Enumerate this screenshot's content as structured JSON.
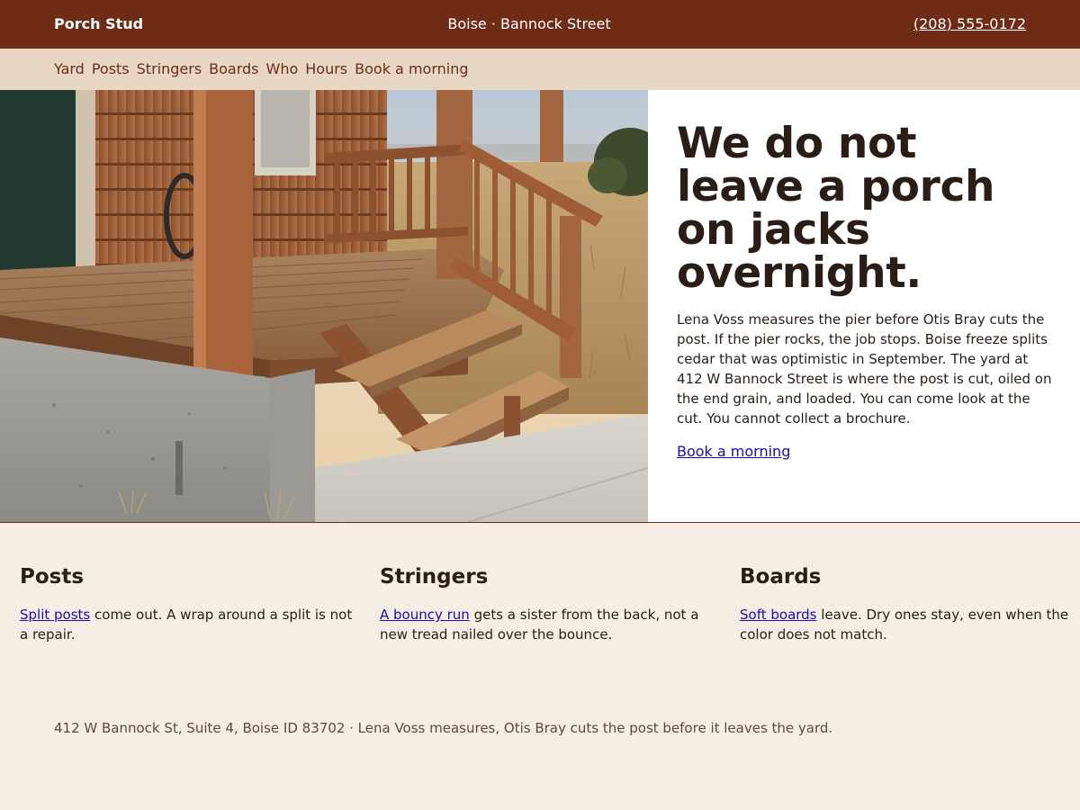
{
  "header": {
    "brand": "Porch Stud",
    "location": "Boise · Bannock Street",
    "phone": "(208) 555-0172"
  },
  "nav": {
    "items": [
      {
        "label": "Yard"
      },
      {
        "label": "Posts"
      },
      {
        "label": "Stringers"
      },
      {
        "label": "Boards"
      },
      {
        "label": "Who"
      },
      {
        "label": "Hours"
      },
      {
        "label": "Book a morning"
      }
    ]
  },
  "hero": {
    "image_icon": "porch-stairs-photo",
    "title": "We do not leave a porch on jacks overnight.",
    "body": "Lena Voss measures the pier before Otis Bray cuts the post. If the pier rocks, the job stops. Boise freeze splits cedar that was optimistic in September. The yard at 412 W Bannock Street is where the post is cut, oiled on the end grain, and loaded. You can come look at the cut. You cannot collect a brochure.",
    "cta": "Book a morning"
  },
  "features": [
    {
      "title": "Posts",
      "link": "Split posts",
      "text": " come out. A wrap around a split is not a repair."
    },
    {
      "title": "Stringers",
      "link": "A bouncy run",
      "text": " gets a sister from the back, not a new tread nailed over the bounce."
    },
    {
      "title": "Boards",
      "link": "Soft boards",
      "text": " leave. Dry ones stay, even when the color does not match."
    }
  ],
  "footer": {
    "text": "412 W Bannock St, Suite 4, Boise ID 83702 · Lena Voss measures, Otis Bray cuts the post before it leaves the yard."
  },
  "colors": {
    "header_bg": "#6e2c17",
    "nav_bg": "#e8d8c3",
    "page_bg": "#f6eee5",
    "link": "#1a0dab"
  }
}
